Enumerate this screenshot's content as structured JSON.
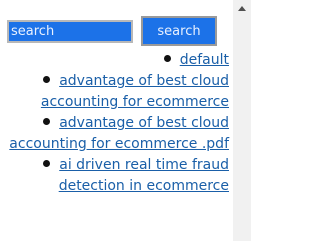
{
  "search": {
    "placeholder": "search",
    "button_label": "search"
  },
  "list": {
    "items": [
      {
        "label": "default",
        "bullet": true
      },
      {
        "label": "advantage of best cloud accounting for ecommerce",
        "bullet": true
      },
      {
        "label": "advantage of best cloud accounting for ecommerce .pdf",
        "bullet": true
      },
      {
        "label": "ai driven real time fraud detection in ecommerce",
        "bullet": true
      }
    ]
  },
  "icons": {
    "scroll_up": "chevron-up-icon",
    "bullet": "bullet-icon"
  }
}
